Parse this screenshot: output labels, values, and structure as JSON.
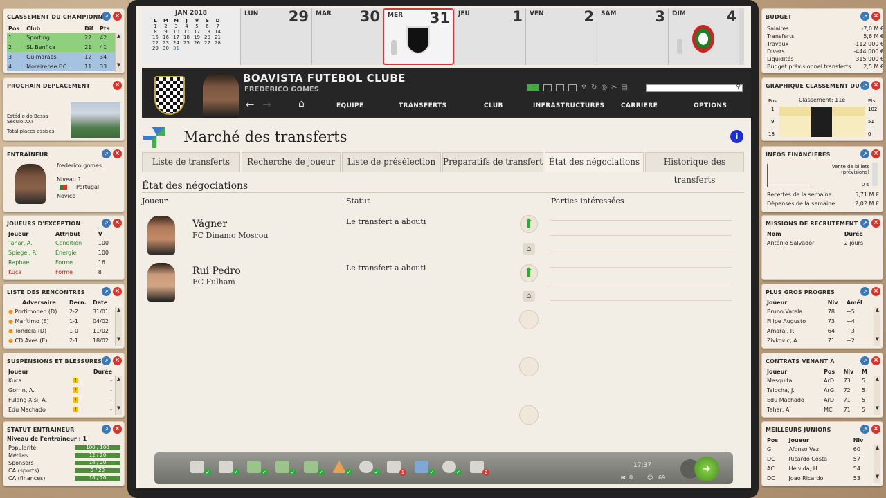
{
  "league": {
    "title": "CLASSEMENT DU CHAMPIONNAT",
    "cols": [
      "Pos",
      "Club",
      "Dif",
      "Pts"
    ],
    "rows": [
      [
        "1",
        "Sporting",
        "22",
        "42"
      ],
      [
        "2",
        "SL Benfica",
        "21",
        "41"
      ],
      [
        "3",
        "Guimarães",
        "12",
        "34"
      ],
      [
        "4",
        "Moreirense F.C.",
        "11",
        "33"
      ]
    ]
  },
  "travel": {
    "title": "PROCHAIN DEPLACEMENT",
    "stadium": "Estádio do Bessa Século XXI",
    "capacity": "Total places assises:"
  },
  "coach": {
    "title": "ENTRAÎNEUR",
    "name": "frederico gomes",
    "level": "Niveau 1",
    "country": "Portugal",
    "rank": "Novice"
  },
  "excep": {
    "title": "JOUEURS D'EXCEPTION",
    "cols": [
      "Joueur",
      "Attribut",
      "V"
    ],
    "rows": [
      [
        "Tahar, A.",
        "Condition",
        "100"
      ],
      [
        "Spiegel, R.",
        "Énergie",
        "100"
      ],
      [
        "Raphael",
        "Forme",
        "16"
      ],
      [
        "Kuca",
        "Forme",
        "8"
      ]
    ]
  },
  "matches": {
    "title": "LISTE DES RENCONTRES",
    "cols": [
      "Adversaire",
      "Dern.",
      "Date"
    ],
    "rows": [
      [
        "Portimonen (D)",
        "2-2",
        "31/01"
      ],
      [
        "Marítimo (E)",
        "1-1",
        "04/02"
      ],
      [
        "Tondela (D)",
        "1-0",
        "11/02"
      ],
      [
        "CD Aves (E)",
        "2-1",
        "18/02"
      ]
    ]
  },
  "injuries": {
    "title": "SUSPENSIONS ET BLESSURES",
    "cols": [
      "Joueur",
      "Durée"
    ],
    "rows": [
      [
        "Kuca",
        "-"
      ],
      [
        "Gorrin, A.",
        "-"
      ],
      [
        "Fulang Xisi, A.",
        "-"
      ],
      [
        "Edu Machado",
        "-"
      ]
    ]
  },
  "coachstat": {
    "title": "STATUT ENTRAINEUR",
    "level": "Niveau de l'entraîneur : 1",
    "rows": [
      [
        "Popularité",
        "100 / 100"
      ],
      [
        "Médias",
        "12 / 20"
      ],
      [
        "Sponsors",
        "14 / 20"
      ],
      [
        "CA (sports)",
        "9 / 20"
      ],
      [
        "CA (finances)",
        "16 / 20"
      ]
    ],
    "fractions": [
      1,
      0.6,
      0.7,
      0.45,
      0.8
    ]
  },
  "calendar": {
    "month": "JAN 2018",
    "weekdays": [
      "L",
      "M",
      "M",
      "J",
      "V",
      "S",
      "D"
    ],
    "weeks": [
      [
        "",
        "",
        "",
        "",
        "",
        "",
        ""
      ],
      [
        "1",
        "2",
        "3",
        "4",
        "5",
        "6",
        "7"
      ],
      [
        "8",
        "9",
        "10",
        "11",
        "12",
        "13",
        "14"
      ],
      [
        "15",
        "16",
        "17",
        "18",
        "19",
        "20",
        "21"
      ],
      [
        "22",
        "23",
        "24",
        "25",
        "26",
        "27",
        "28"
      ],
      [
        "29",
        "30",
        "31",
        "",
        "",
        "",
        ""
      ]
    ],
    "days": [
      [
        "LUN",
        "29"
      ],
      [
        "MAR",
        "30"
      ],
      [
        "MER",
        "31"
      ],
      [
        "JEU",
        "1"
      ],
      [
        "VEN",
        "2"
      ],
      [
        "SAM",
        "3"
      ],
      [
        "DIM",
        "4"
      ]
    ]
  },
  "header": {
    "club": "BOAVISTA FUTEBOL CLUBE",
    "manager": "FREDERICO GOMES",
    "search_placeholder": ""
  },
  "nav": [
    "EQUIPE",
    "TRANSFERTS",
    "CLUB",
    "INFRASTRUCTURES",
    "CARRIERE",
    "OPTIONS"
  ],
  "page": {
    "title": "Marché des transferts",
    "subtitle": "État des négociations",
    "tabs": [
      "Liste de transferts",
      "Recherche de joueur",
      "Liste de présélection",
      "Préparatifs de transfert",
      "État des négociations",
      "Historique des transferts"
    ],
    "cols": [
      "Joueur",
      "Statut",
      "Parties intéressées"
    ],
    "rows": [
      {
        "name": "Vágner",
        "club": "FC Dinamo Moscou",
        "status": "Le transfert a abouti"
      },
      {
        "name": "Rui Pedro",
        "club": "FC Fulham",
        "status": "Le transfert a abouti"
      }
    ]
  },
  "dock": {
    "time": "17:37",
    "mail": "0",
    "count": "69",
    "badge1": "1",
    "badge2": "2"
  },
  "budget": {
    "title": "BUDGET",
    "rows": [
      [
        "Salaires",
        "-7,0 M €"
      ],
      [
        "Transferts",
        "5,6 M €"
      ],
      [
        "Travaux",
        "-112 000 €"
      ],
      [
        "Divers",
        "-444 000 €"
      ],
      [
        "Liquidités",
        "315 000 €"
      ],
      [
        "Budget prévisionnel transferts",
        "2,5 M €"
      ]
    ]
  },
  "rankgraph": {
    "title": "GRAPHIQUE CLASSEMENT DU",
    "left": [
      "Pos",
      "1",
      "9",
      "18"
    ],
    "caption": "Classement: 11e",
    "right": [
      "Pts",
      "102",
      "51",
      "0"
    ]
  },
  "finance": {
    "title": "INFOS FINANCIERES",
    "label": "Vente de billets (prévisions)",
    "value": "0 €",
    "rows": [
      [
        "Recettes de la semaine",
        "5,71 M €"
      ],
      [
        "Dépenses de la semaine",
        "2,02 M €"
      ]
    ]
  },
  "missions": {
    "title": "MISSIONS DE RECRUTEMENT",
    "cols": [
      "Nom",
      "Durée"
    ],
    "rows": [
      [
        "António Salvador",
        "2 jours"
      ]
    ]
  },
  "progress": {
    "title": "PLUS GROS PROGRES",
    "cols": [
      "Joueur",
      "Niv",
      "Amél"
    ],
    "rows": [
      [
        "Bruno Varela",
        "78",
        "+5"
      ],
      [
        "Filipe Augusto",
        "73",
        "+4"
      ],
      [
        "Amaral, P.",
        "64",
        "+3"
      ],
      [
        "Zivkovic, A.",
        "71",
        "+2"
      ]
    ]
  },
  "contracts": {
    "title": "CONTRATS VENANT A",
    "cols": [
      "Joueur",
      "Pos",
      "Niv",
      "M"
    ],
    "rows": [
      [
        "Mesquita",
        "ArD",
        "73",
        "5"
      ],
      [
        "Talocha, J.",
        "ArG",
        "72",
        "5"
      ],
      [
        "Edu Machado",
        "ArD",
        "71",
        "5"
      ],
      [
        "Tahar, A.",
        "MC",
        "71",
        "5"
      ]
    ]
  },
  "juniors": {
    "title": "MEILLEURS JUNIORS",
    "cols": [
      "Pos",
      "Joueur",
      "Niv"
    ],
    "rows": [
      [
        "G",
        "Afonso Vaz",
        "60"
      ],
      [
        "DC",
        "Ricardo Costa",
        "57"
      ],
      [
        "AC",
        "Helvida, H.",
        "54"
      ],
      [
        "DC",
        "Joao Ricardo",
        "53"
      ]
    ]
  }
}
